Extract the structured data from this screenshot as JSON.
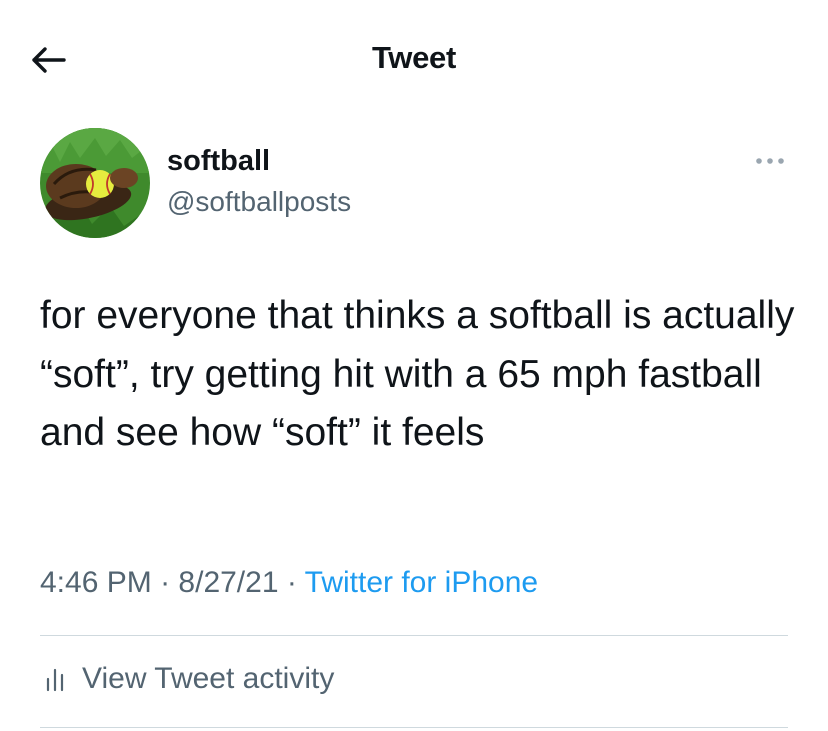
{
  "header": {
    "title": "Tweet",
    "back_icon": "arrow-left-icon"
  },
  "author": {
    "display_name": "softball",
    "handle": "@softballposts",
    "more_icon": "more-horizontal-icon"
  },
  "tweet": {
    "text": "for everyone that thinks a softball is actually “soft”, try getting hit with a 65 mph fastball and see how “soft” it feels",
    "time": "4:46 PM",
    "separator": "·",
    "date": "8/27/21",
    "source": "Twitter for iPhone"
  },
  "activity": {
    "label": "View Tweet activity",
    "icon": "analytics-icon"
  },
  "colors": {
    "text": "#0f1419",
    "secondary": "#536471",
    "link": "#1d9bf0",
    "divider": "#cfd9de"
  }
}
